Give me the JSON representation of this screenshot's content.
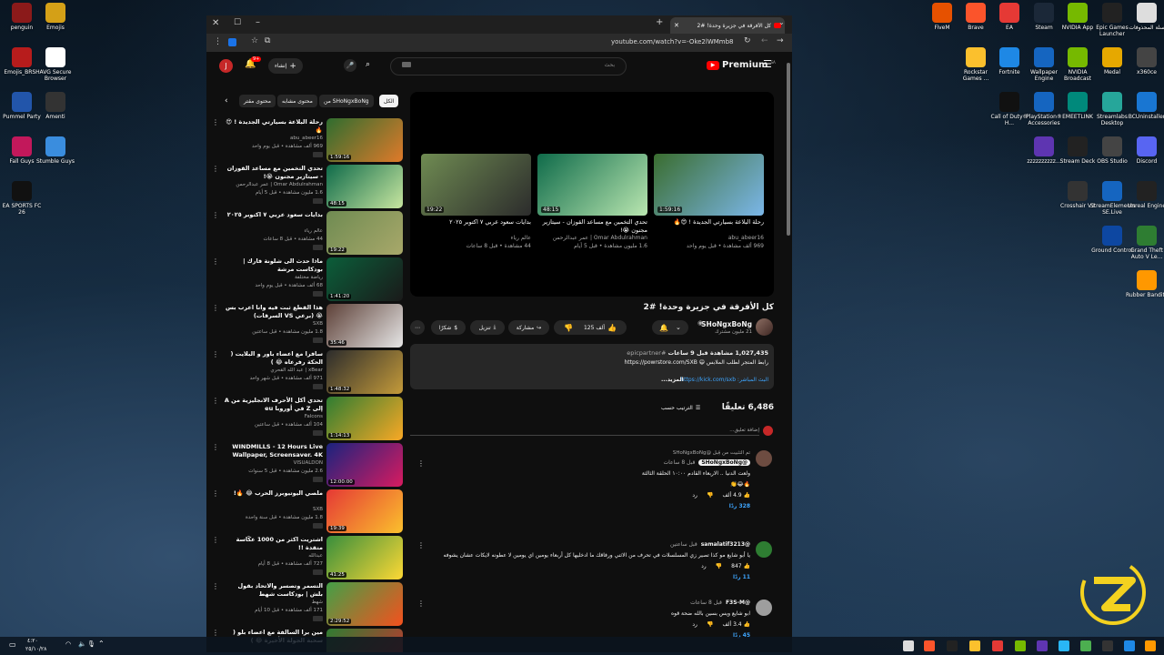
{
  "desktop": {
    "left_icons": [
      "penguin",
      "Emojis",
      "Emojis_BRSH",
      "AVG Secure Browser",
      "Pummel Party",
      "Amenti",
      "Fall Guys",
      "Stumble Guys",
      "EA SPORTS FC 26"
    ],
    "right_icons": [
      "FiveM",
      "Brave",
      "EA",
      "Steam",
      "NVIDIA App",
      "Epic Games Launcher",
      "سلة المحذوفات",
      "Rockstar Games ...",
      "Fortnite",
      "Wallpaper Engine",
      "NVIDIA Broadcast",
      "Medal",
      "x360ce",
      "Call of Duty® H...",
      "PlayStation® Accessories",
      "EMEETLINK",
      "Streamlabs Desktop",
      "BCUninstaller",
      "zzzzzzzzzz...",
      "Stream Deck",
      "OBS Studio",
      "Discord",
      "Crosshair V2",
      "StreamElements SE.Live",
      "Unreal Engine",
      "Ground Control",
      "Grand Theft Auto V Le...",
      "Rubber Bandits"
    ]
  },
  "browser": {
    "tab_title": "كل الأفرقة في جزيرة وحدة! #2",
    "url": "youtube.com/watch?v=-Oke2lWMmb8"
  },
  "yt": {
    "logo": "Premium",
    "logo_sup": "SA",
    "search_placeholder": "بحث",
    "create_label": "إنشاء",
    "notif_count": "9+",
    "avatar_letter": "J",
    "chips": [
      "الكل",
      "من SHoNgxBoNg",
      "محتوى مشابه",
      "محتوى مقتر"
    ],
    "video_title": "كل الأفرقة في جزيرة وحدة! #2",
    "channel_name": "SHoNgxBoNg",
    "subscribers": "21 مليون مشترك",
    "likes": "125 ألف",
    "share": "مشاركة",
    "download": "تنزيل",
    "thanks": "شكرًا",
    "desc_stats": "1,027,435 مشاهدة قبل 9 ساعات",
    "desc_tag": "#epicpartner",
    "desc_line1": "رابط المتجر لطلب الملابس 😄 https://powrstore.com/SXB",
    "desc_line2": "البث المباشر: https://kick.com/sxb",
    "desc_more": "...المزيد",
    "comments_count": "6,486 تعليقًا",
    "sort_by": "الترتيب حسب",
    "add_comment": "إضافة تعليق...",
    "endcards": [
      {
        "title": "رحلة البلاعة بسيارتي الجديدة ! 😍🔥",
        "channel": "abu_abeer16",
        "meta": "969 ألف مشاهدة • قبل يوم واحد",
        "duration": "1:59:16"
      },
      {
        "title": "تحدي التخمين مع مساعد القوزان - سيتازير مجنون 😭!",
        "channel": "Omar Abdulrahman | عمر عبدالرحمن",
        "meta": "1.6 مليون مشاهدة • قبل 5 أيام",
        "duration": "48:15"
      },
      {
        "title": "بدايات سعود عربي ٧ اكتوبر ٢٠٢٥",
        "channel": "عالم رياء",
        "meta": "44 مشاهدة • قبل 8 ساعات",
        "duration": "19:22"
      }
    ],
    "sidebar": [
      {
        "title": "رحلة البلاعة بسيارتي الجديدة ! 😍🔥",
        "channel": "abu_abeer16",
        "meta": "969 ألف مشاهدة • قبل يوم واحد",
        "duration": "1:59:16"
      },
      {
        "title": "تحدي التخمين مع مساعد القوزان - سيتازير مجنون 😭!",
        "channel": "Omar Abdulrahman | عمر عبدالرحمن",
        "meta": "1.6 مليون مشاهدة • قبل 5 أيام",
        "duration": "48:15"
      },
      {
        "title": "بدايات سعود عربي ٧ اكتوبر ٢٠٢٥",
        "channel": "عالم رياء",
        "meta": "44 مشاهدة • قبل 8 ساعات",
        "duration": "19:22"
      },
      {
        "title": "ماذا حدث الى شلونة فارك | بودكاست مرشة",
        "channel": "رياضة مختلفة",
        "meta": "68 ألف مشاهدة • قبل يوم واحد",
        "duration": "1:41:20"
      },
      {
        "title": "هذا القطع ثبت فيه وانا اعرب بس 😭 (برعي VS السرقات)",
        "channel": "SXB",
        "meta": "1.8 مليون مشاهدة • قبل ساعتين",
        "duration": "35:46"
      },
      {
        "title": "سافرا مع اعضاء باور و البلايت ( الحكة رفرعاه 😂 )",
        "channel": "xBear | عبد الله القحري",
        "meta": "971 ألف مشاهدة • قبل شهر واحد",
        "duration": "1:48:32"
      },
      {
        "title": "تحدي أكل الأحرف الانجليزية من A إلى Z في أوروبا eu",
        "channel": "Falcons",
        "meta": "104 ألف مشاهدة • قبل ساعتين",
        "duration": "1:14:13"
      },
      {
        "title": "WINDMILLS - 12 Hours Live Wallpaper, Screensaver. 4K Ultra",
        "channel": "VISUALDON",
        "meta": "2.6 مليون مشاهدة • قبل 5 سنوات",
        "duration": "12:00:00"
      },
      {
        "title": "ملصي اليوتيوبرز الحرب 😂 🔥!",
        "channel": "SXB",
        "meta": "1.8 مليون مشاهدة • قبل سنة واحدة",
        "duration": "19:39"
      },
      {
        "title": "اشتريت اكثر من 1000 عكّاسة متقدة !!",
        "channel": "عبدالله",
        "meta": "727 ألف مشاهدة • قبل 8 أيام",
        "duration": "41:25"
      },
      {
        "title": "التسمر وتصسر والاتحاد بقول بلش | بودكاست شهط",
        "channel": "شهط",
        "meta": "171 ألف مشاهدة • قبل 10 أيام",
        "duration": "2:29:52"
      },
      {
        "title": "مين برا السالفة مع اعضاء بلو ( سحبة الجولة الأخيرة 😂 )",
        "channel": "",
        "meta": "",
        "duration": ""
      }
    ],
    "comments": [
      {
        "author": "@SHoNgxBoNg",
        "pinned": "تم التثبيت من قِبل @SHoNgxBoNg",
        "time": "قبل 8 ساعات",
        "text": "ولعت الدنيا .. الاربعاء القادم ١٠:٠٠ الحلقة الثالثة",
        "emojis": "🔥😂👏",
        "likes": "4.9 ألف",
        "reply": "رد",
        "replies": "328 ردًا"
      },
      {
        "author": "@samalatif3213",
        "time": "قبل ساعتين",
        "text": "يا أبو شايع مو كذا تصير زي المسلسلات في تحرف من الاثني ورفاقك ما ادخليها كل أربعاء يومين اي يومين لا عطونه لايكات عشان يشوفه",
        "likes": "847",
        "reply": "رد",
        "replies": "11 ردًا"
      },
      {
        "author": "@F3S-M",
        "time": "قبل 8 ساعات",
        "text": "ابو شايع ويس بسين بالله ضحة قوه",
        "likes": "3.4 ألف",
        "reply": "رد",
        "replies": "45 ردًا"
      }
    ]
  },
  "taskbar": {
    "time": "٤:٢٠",
    "date": "٢٥/١٠/٢٨"
  },
  "colors": {
    "yt_red": "#ff0000",
    "link": "#3ea6ff",
    "bg": "#0f0f0f"
  }
}
